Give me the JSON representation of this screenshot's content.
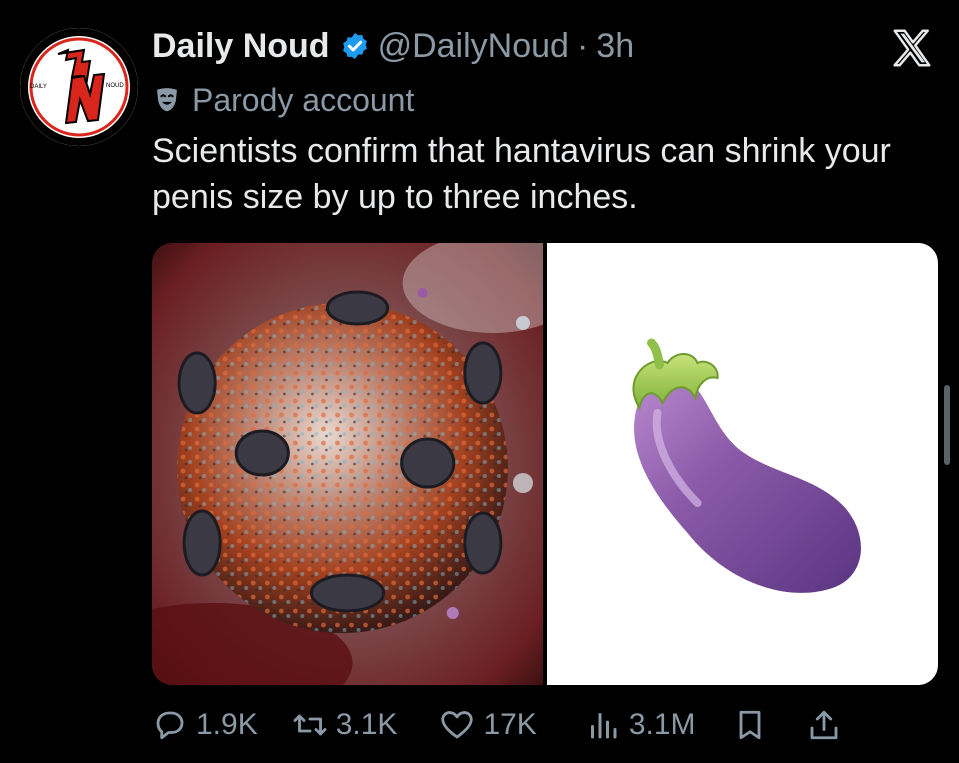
{
  "account": {
    "display_name": "Daily Noud",
    "handle": "@DailyNoud",
    "separator": "·",
    "time": "3h",
    "label": "Parody account",
    "avatar_initials": "DN",
    "avatar_left_text": "DAILY",
    "avatar_right_text": "NOUD"
  },
  "tweet": {
    "text": "Scientists confirm that hantavirus can shrink your penis size by up to three inches."
  },
  "media": [
    {
      "name": "hantavirus-image",
      "icon": "virus-illustration"
    },
    {
      "name": "eggplant-image",
      "icon": "eggplant-emoji"
    }
  ],
  "stats": {
    "replies": "1.9K",
    "reposts": "3.1K",
    "likes": "17K",
    "views": "3.1M"
  },
  "colors": {
    "background": "#000000",
    "text": "#e7e9ea",
    "muted": "#8b98a5",
    "verified": "#1d9bf0",
    "avatar_red": "#d8261c"
  }
}
